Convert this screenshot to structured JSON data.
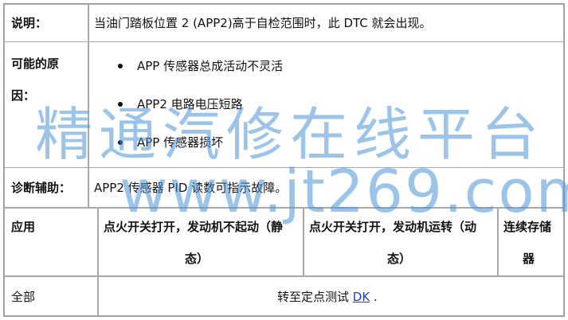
{
  "rows": {
    "description": {
      "label": "说明：",
      "text": "当油门踏板位置 2 (APP2)高于自检范围时，此 DTC 就会出现。"
    },
    "causes": {
      "label_line1": "可能的原",
      "label_line2": "因：",
      "items": [
        "APP 传感器总成活动不灵活",
        "APP2 电路电压短路",
        "APP 传感器损坏"
      ]
    },
    "diagnostic_aid": {
      "label": "诊断辅助：",
      "text": "APP2 传感器 PID 读数可指示故障。"
    }
  },
  "table": {
    "headers": {
      "application": "应用",
      "koeo_line1": "点火开关打开，发动机不起动（静",
      "koeo_line2": "态）",
      "koer_line1": "点火开关打开，发动机运转（动",
      "koer_line2": "态）",
      "continuous_line1": "连续存储",
      "continuous_line2": "器"
    },
    "row": {
      "application": "全部",
      "action_prefix": "转至定点测试",
      "link_text": "DK",
      "action_suffix": "."
    }
  },
  "watermark": {
    "chinese": "精通汽修在线平台",
    "url": "www.jt269.com"
  }
}
